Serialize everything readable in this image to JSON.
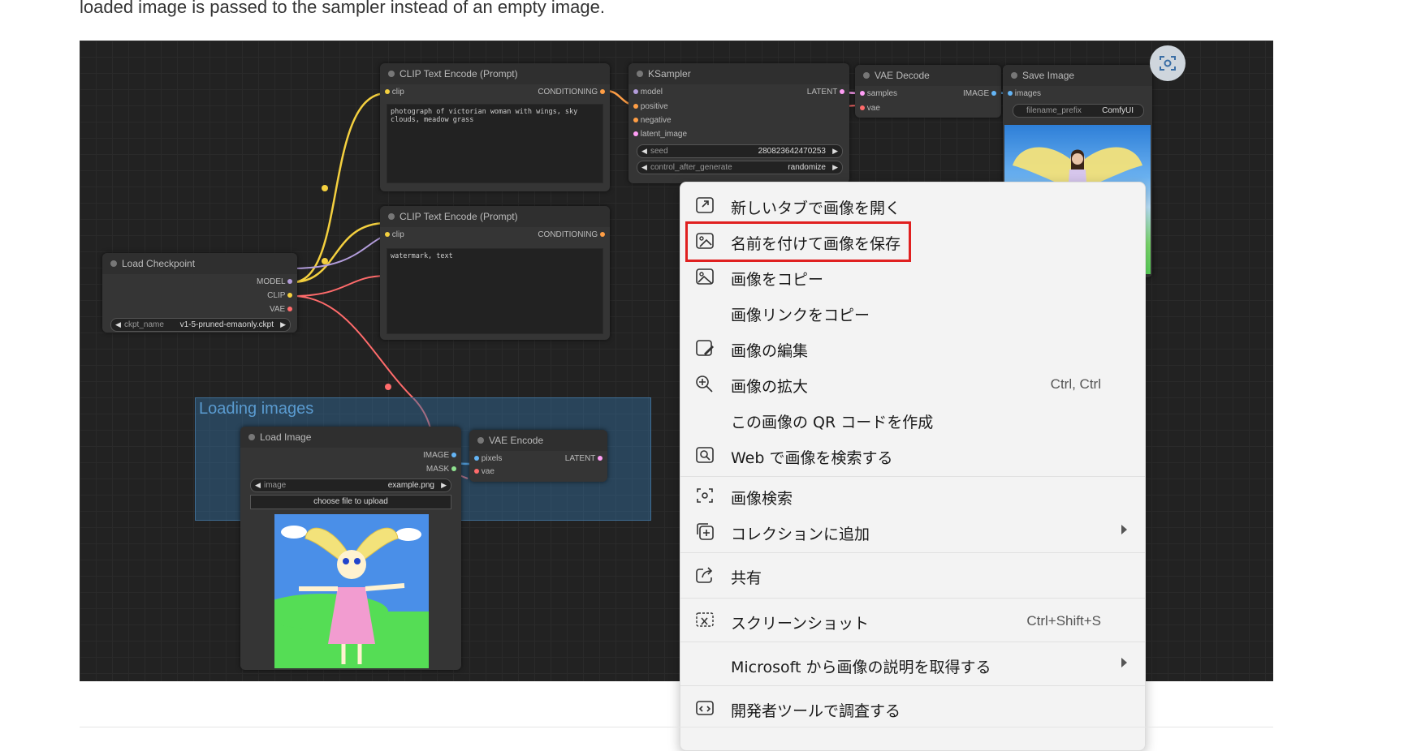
{
  "page": {
    "intro_text": "loaded image is passed to the sampler instead of an empty image."
  },
  "comfy": {
    "group_title": "Loading images",
    "clip_pos": {
      "title": "CLIP Text Encode (Prompt)",
      "in_clip": "clip",
      "out_conditioning": "CONDITIONING",
      "text": "photograph of victorian woman with wings, sky clouds, meadow grass"
    },
    "clip_neg": {
      "title": "CLIP Text Encode (Prompt)",
      "in_clip": "clip",
      "out_conditioning": "CONDITIONING",
      "text": "watermark, text"
    },
    "ksampler": {
      "title": "KSampler",
      "in_model": "model",
      "in_positive": "positive",
      "in_negative": "negative",
      "in_latent": "latent_image",
      "out_latent": "LATENT",
      "seed_label": "seed",
      "seed_value": "280823642470253",
      "cag_label": "control_after_generate",
      "cag_value": "randomize"
    },
    "vae_decode": {
      "title": "VAE Decode",
      "in_samples": "samples",
      "in_vae": "vae",
      "out_image": "IMAGE"
    },
    "save_image": {
      "title": "Save Image",
      "in_images": "images",
      "prefix_label": "filename_prefix",
      "prefix_value": "ComfyUI"
    },
    "checkpoint": {
      "title": "Load Checkpoint",
      "out_model": "MODEL",
      "out_clip": "CLIP",
      "out_vae": "VAE",
      "ckpt_label": "ckpt_name",
      "ckpt_value": "v1-5-pruned-emaonly.ckpt"
    },
    "load_image": {
      "title": "Load Image",
      "out_image": "IMAGE",
      "out_mask": "MASK",
      "image_label": "image",
      "image_value": "example.png",
      "upload_label": "choose file to upload"
    },
    "vae_encode": {
      "title": "VAE Encode",
      "in_pixels": "pixels",
      "in_vae": "vae",
      "out_latent": "LATENT"
    }
  },
  "menu": {
    "items": [
      {
        "label": "新しいタブで画像を開く",
        "icon": "open-in-new-tab-icon"
      },
      {
        "label": "名前を付けて画像を保存",
        "icon": "save-image-icon"
      },
      {
        "label": "画像をコピー",
        "icon": "copy-image-icon"
      },
      {
        "label": "画像リンクをコピー",
        "icon": ""
      },
      {
        "label": "画像の編集",
        "icon": "edit-image-icon"
      },
      {
        "label": "画像の拡大",
        "icon": "zoom-in-icon",
        "shortcut": "Ctrl, Ctrl"
      },
      {
        "label": "この画像の QR コードを作成",
        "icon": ""
      },
      {
        "label": "Web で画像を検索する",
        "icon": "web-image-search-icon"
      },
      {
        "label": "画像検索",
        "icon": "visual-search-icon"
      },
      {
        "label": "コレクションに追加",
        "icon": "add-to-collection-icon"
      },
      {
        "label": "共有",
        "icon": "share-icon"
      },
      {
        "label": "スクリーンショット",
        "icon": "screenshot-icon",
        "shortcut": "Ctrl+Shift+S"
      },
      {
        "label": "Microsoft から画像の説明を取得する",
        "icon": ""
      },
      {
        "label": "開発者ツールで調査する",
        "icon": "devtools-icon"
      }
    ]
  },
  "colors": {
    "highlight": "#e02020",
    "wire_clip": "#f4d03f",
    "wire_vae": "#ff6b6b",
    "wire_image": "#64b5f6",
    "wire_latent": "#ff9ef5",
    "wire_model": "#b39ddb"
  }
}
